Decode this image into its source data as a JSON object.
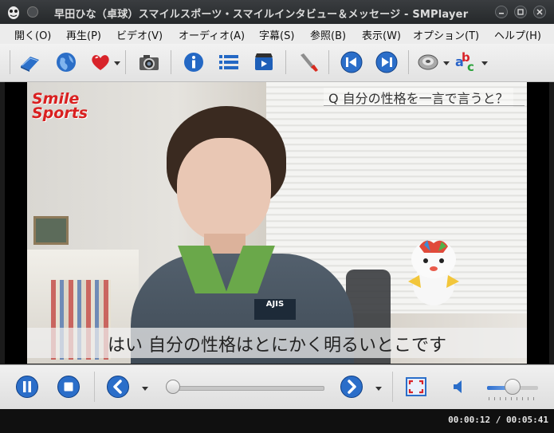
{
  "window": {
    "title": "早田ひな（卓球）スマイルスポーツ・スマイルインタビュー＆メッセージ - SMPlayer"
  },
  "menubar": {
    "items": [
      {
        "label": "開く(O)"
      },
      {
        "label": "再生(P)"
      },
      {
        "label": "ビデオ(V)"
      },
      {
        "label": "オーディオ(A)"
      },
      {
        "label": "字幕(S)"
      },
      {
        "label": "参照(B)"
      },
      {
        "label": "表示(W)"
      },
      {
        "label": "オプション(T)"
      },
      {
        "label": "ヘルプ(H)"
      }
    ]
  },
  "toolbar": {
    "icons": [
      "open-file-icon",
      "open-url-icon",
      "favorites-icon",
      "screenshot-icon",
      "info-icon",
      "playlist-icon",
      "video-effects-icon",
      "preferences-icon",
      "previous-icon",
      "next-icon",
      "audio-track-icon",
      "subtitle-track-icon"
    ]
  },
  "video": {
    "brand_line1": "Smile",
    "brand_line2": "Sports",
    "question": "Q 自分の性格を一言で言うと？",
    "subtitle": "はい 自分の性格はとにかく明るいとこです",
    "badge": "AJIS"
  },
  "controls": {
    "seek_progress": 0.035,
    "volume_level": 0.5
  },
  "status": {
    "time": "00:00:12 / 00:05:41"
  },
  "colors": {
    "accent_blue": "#2f6fcf",
    "title_bg": "#2f3235",
    "brand_red": "#d92020"
  }
}
